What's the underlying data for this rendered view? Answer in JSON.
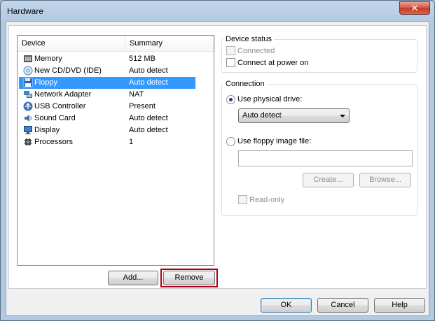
{
  "window": {
    "title": "Hardware",
    "close_glyph": "✕"
  },
  "device_list": {
    "columns": {
      "device": "Device",
      "summary": "Summary"
    },
    "rows": [
      {
        "name": "Memory",
        "summary": "512 MB",
        "icon": "memory-icon"
      },
      {
        "name": "New CD/DVD (IDE)",
        "summary": "Auto detect",
        "icon": "cd-dvd-icon"
      },
      {
        "name": "Floppy",
        "summary": "Auto detect",
        "icon": "floppy-icon",
        "selected": true
      },
      {
        "name": "Network Adapter",
        "summary": "NAT",
        "icon": "network-adapter-icon"
      },
      {
        "name": "USB Controller",
        "summary": "Present",
        "icon": "usb-icon"
      },
      {
        "name": "Sound Card",
        "summary": "Auto detect",
        "icon": "sound-card-icon"
      },
      {
        "name": "Display",
        "summary": "Auto detect",
        "icon": "display-icon"
      },
      {
        "name": "Processors",
        "summary": "1",
        "icon": "processor-icon"
      }
    ],
    "add_label": "Add...",
    "remove_label": "Remove"
  },
  "device_status": {
    "title": "Device status",
    "connected_label": "Connected",
    "connect_at_power_on_label": "Connect at power on"
  },
  "connection": {
    "title": "Connection",
    "physical_drive_label": "Use physical drive:",
    "physical_drive_value": "Auto detect",
    "floppy_image_label": "Use floppy image file:",
    "floppy_image_value": "",
    "create_label": "Create...",
    "browse_label": "Browse...",
    "read_only_label": "Read-only"
  },
  "footer": {
    "ok_label": "OK",
    "cancel_label": "Cancel",
    "help_label": "Help"
  },
  "colors": {
    "selection": "#3399ff",
    "remove_highlight": "#b0001a"
  }
}
